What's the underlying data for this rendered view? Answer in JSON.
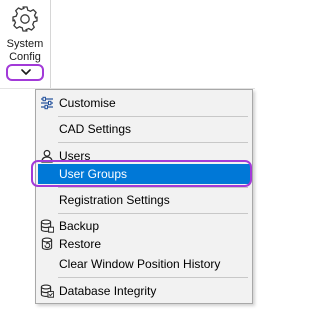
{
  "ribbon": {
    "system_config": {
      "line1": "System",
      "line2": "Config",
      "icon": "gear-icon",
      "dropdown_icon": "chevron-down-icon"
    }
  },
  "menu": {
    "items": [
      {
        "label": "Customise",
        "icon": "sliders-icon"
      },
      {
        "label": "CAD Settings",
        "icon": ""
      },
      {
        "label": "Users",
        "icon": "user-icon"
      },
      {
        "label": "User Groups",
        "icon": "",
        "selected": true
      },
      {
        "label": "Registration Settings",
        "icon": ""
      },
      {
        "label": "Backup",
        "icon": "database-backup-icon"
      },
      {
        "label": "Restore",
        "icon": "database-restore-icon"
      },
      {
        "label": "Clear Window Position History",
        "icon": ""
      },
      {
        "label": "Database Integrity",
        "icon": "database-integrity-icon"
      }
    ]
  },
  "colors": {
    "highlight_outline": "#a23ad8",
    "selection": "#0078d7",
    "menu_background": "#f2f2f2"
  }
}
